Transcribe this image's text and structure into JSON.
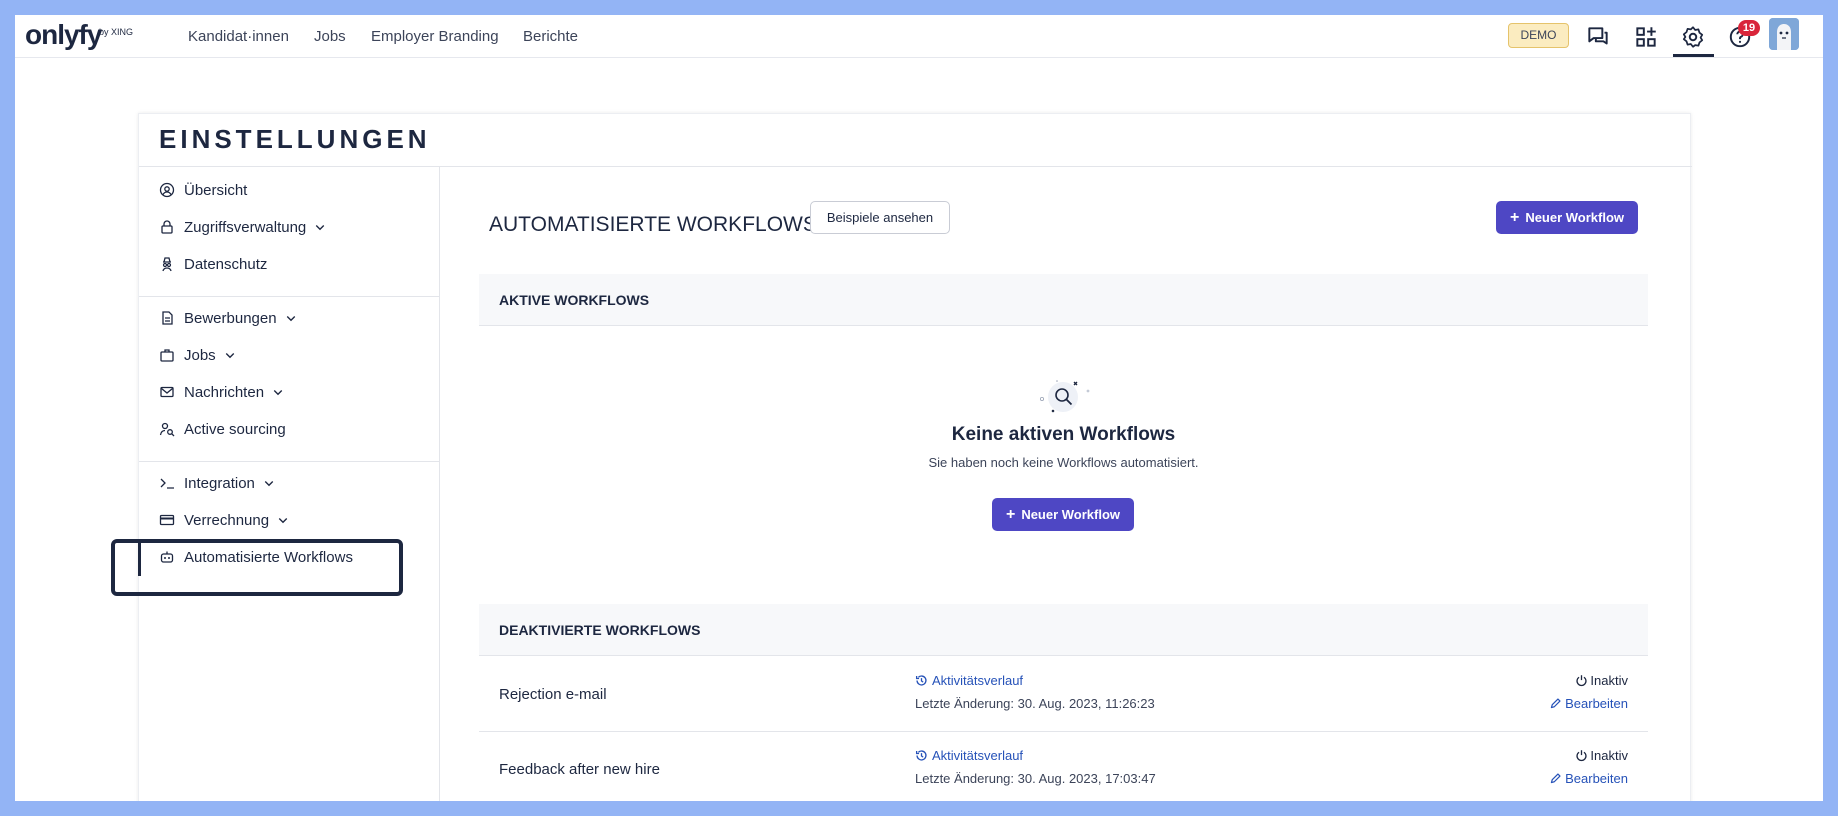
{
  "logo": {
    "name": "onlyfy",
    "sub": "by XING"
  },
  "nav": [
    "Kandidat·innen",
    "Jobs",
    "Employer Branding",
    "Berichte"
  ],
  "topbar": {
    "demo": "DEMO",
    "notifications": "19"
  },
  "page": {
    "title": "EINSTELLUNGEN"
  },
  "sidebar": {
    "items": [
      {
        "label": "Übersicht"
      },
      {
        "label": "Zugriffsverwaltung"
      },
      {
        "label": "Datenschutz"
      },
      {
        "label": "Bewerbungen"
      },
      {
        "label": "Jobs"
      },
      {
        "label": "Nachrichten"
      },
      {
        "label": "Active sourcing"
      },
      {
        "label": "Integration"
      },
      {
        "label": "Verrechnung"
      },
      {
        "label": "Automatisierte Workflows"
      }
    ]
  },
  "main": {
    "title": "AUTOMATISIERTE WORKFLOWS",
    "examples_button": "Beispiele ansehen",
    "new_workflow_button": "Neuer Workflow",
    "active": {
      "heading": "AKTIVE WORKFLOWS",
      "empty_title": "Keine aktiven Workflows",
      "empty_sub": "Sie haben noch keine Workflows automatisiert.",
      "button": "Neuer Workflow"
    },
    "inactive": {
      "heading": "DEAKTIVIERTE WORKFLOWS",
      "rows": [
        {
          "name": "Rejection e-mail",
          "activity": "Aktivitätsverlauf",
          "date": "Letzte Änderung: 30. Aug. 2023, 11:26:23",
          "status": "Inaktiv",
          "edit": "Bearbeiten"
        },
        {
          "name": "Feedback after new hire",
          "activity": "Aktivitätsverlauf",
          "date": "Letzte Änderung: 30. Aug. 2023, 17:03:47",
          "status": "Inaktiv",
          "edit": "Bearbeiten"
        }
      ]
    }
  },
  "colors": {
    "primary": "#4e47c4",
    "link": "#2652b8",
    "text": "#1d2740",
    "frame": "#93b4f5",
    "badge": "#d9253a"
  }
}
